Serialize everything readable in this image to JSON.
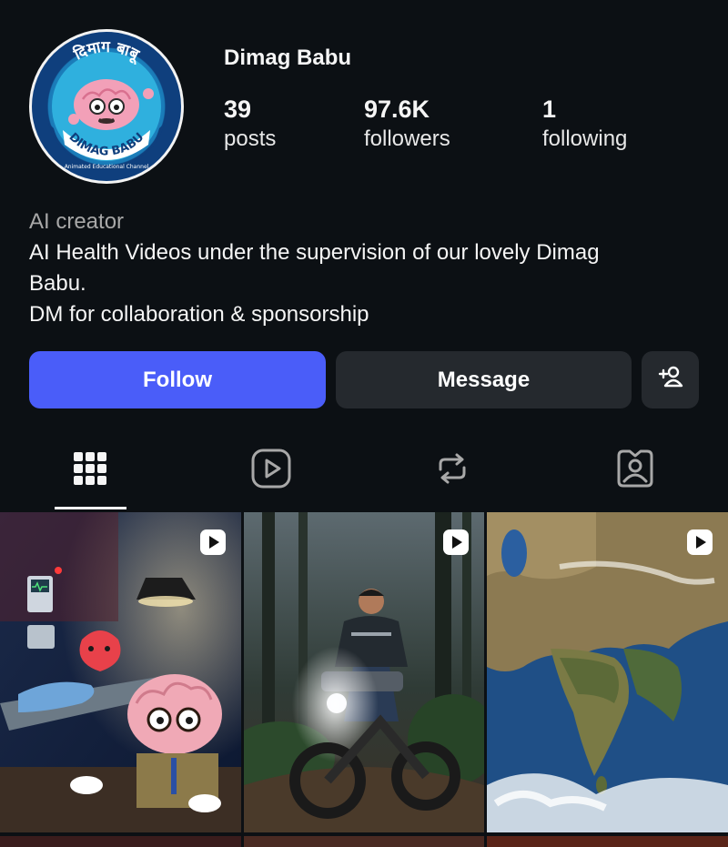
{
  "profile": {
    "username": "Dimag Babu",
    "avatar": {
      "logo_text_top": "दिमाग बाबू",
      "logo_text_bottom": "DIMAG BABU",
      "logo_tagline": "Animated Educational Channel"
    },
    "stats": {
      "posts": {
        "value": "39",
        "label": "posts"
      },
      "followers": {
        "value": "97.6K",
        "label": "followers"
      },
      "following": {
        "value": "1",
        "label": "following"
      }
    },
    "bio": {
      "category": "AI creator",
      "line1": "AI Health Videos under the supervision of our lovely Dimag",
      "line2": "Babu.",
      "line3": "DM for collaboration & sponsorship"
    }
  },
  "actions": {
    "follow_label": "Follow",
    "message_label": "Message",
    "add_friend_icon": "person-add-icon"
  },
  "tabs": [
    {
      "icon": "grid-icon",
      "active": true
    },
    {
      "icon": "reels-icon",
      "active": false
    },
    {
      "icon": "reposts-icon",
      "active": false
    },
    {
      "icon": "tagged-icon",
      "active": false
    }
  ],
  "posts": [
    {
      "type": "reel",
      "icon": "reel-badge-icon"
    },
    {
      "type": "reel",
      "icon": "reel-badge-icon"
    },
    {
      "type": "reel",
      "icon": "reel-badge-icon"
    }
  ],
  "colors": {
    "background": "#0c1014",
    "follow_button": "#4a5df9",
    "secondary_button": "#25292e",
    "muted_text": "#a8a8a8"
  }
}
